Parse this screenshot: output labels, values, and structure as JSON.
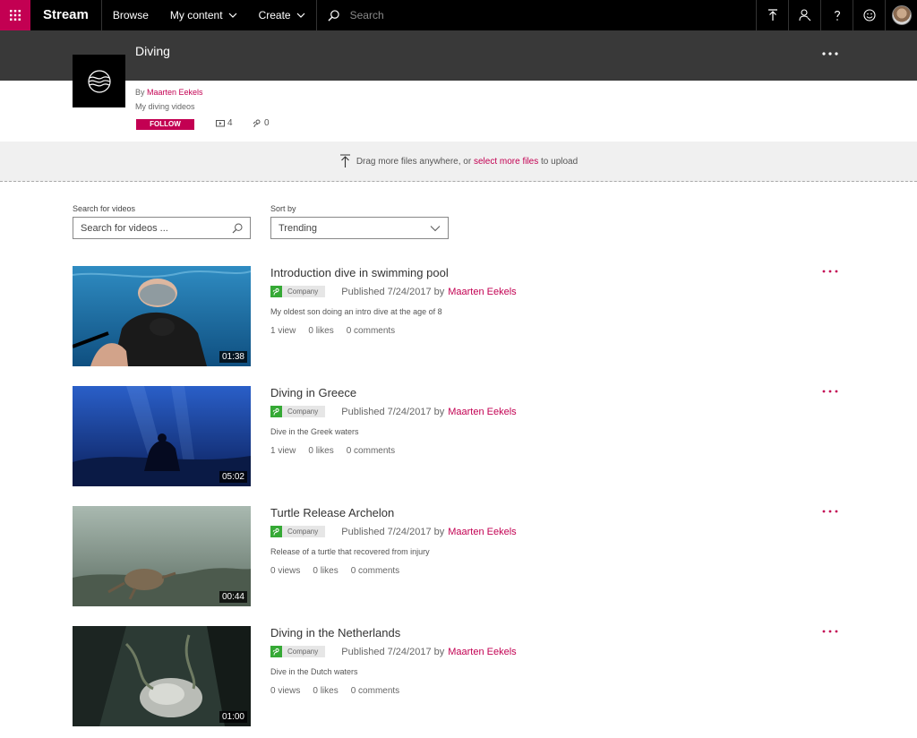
{
  "nav": {
    "brand": "Stream",
    "browse": "Browse",
    "my_content": "My content",
    "create": "Create",
    "search_placeholder": "Search"
  },
  "channel": {
    "title": "Diving",
    "by_prefix": "By ",
    "owner": "Maarten Eekels",
    "description": "My diving videos",
    "follow_label": "FOLLOW",
    "video_count": "4",
    "follower_count": "0"
  },
  "upload": {
    "prefix": "Drag more files anywhere, or ",
    "link": "select more files",
    "suffix": " to upload"
  },
  "filters": {
    "search_label": "Search for videos",
    "search_placeholder": "Search for videos ...",
    "sort_label": "Sort by",
    "sort_value": "Trending"
  },
  "videos": [
    {
      "title": "Introduction dive in swimming pool",
      "badge": "Company",
      "published": "Published 7/24/2017 by",
      "author": "Maarten Eekels",
      "description": "My oldest son doing an intro dive at the age of 8",
      "views": "1 view",
      "likes": "0 likes",
      "comments": "0 comments",
      "duration": "01:38"
    },
    {
      "title": "Diving in Greece",
      "badge": "Company",
      "published": "Published 7/24/2017 by",
      "author": "Maarten Eekels",
      "description": "Dive in the Greek waters",
      "views": "1 view",
      "likes": "0 likes",
      "comments": "0 comments",
      "duration": "05:02"
    },
    {
      "title": "Turtle Release Archelon",
      "badge": "Company",
      "published": "Published 7/24/2017 by",
      "author": "Maarten Eekels",
      "description": "Release of a turtle that recovered from injury",
      "views": "0 views",
      "likes": "0 likes",
      "comments": "0 comments",
      "duration": "00:44"
    },
    {
      "title": "Diving in the Netherlands",
      "badge": "Company",
      "published": "Published 7/24/2017 by",
      "author": "Maarten Eekels",
      "description": "Dive in the Dutch waters",
      "views": "0 views",
      "likes": "0 likes",
      "comments": "0 comments",
      "duration": "01:00"
    }
  ],
  "colors": {
    "accent": "#c30052",
    "badge_green": "#35a935",
    "header_dark": "#393939"
  }
}
